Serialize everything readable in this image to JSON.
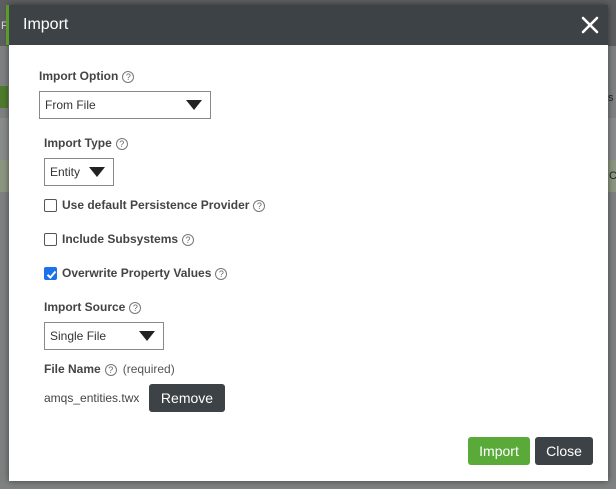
{
  "background": {
    "left_char": "F",
    "right_char_1": "s",
    "right_char_2": "C"
  },
  "dialog": {
    "title": "Import",
    "close_glyph": "×",
    "import_option": {
      "label": "Import Option",
      "value": "From File"
    },
    "import_type": {
      "label": "Import Type",
      "value": "Entity"
    },
    "checkboxes": [
      {
        "label": "Use default Persistence Provider",
        "checked": false
      },
      {
        "label": "Include Subsystems",
        "checked": false
      },
      {
        "label": "Overwrite Property Values",
        "checked": true
      }
    ],
    "import_source": {
      "label": "Import Source",
      "value": "Single File"
    },
    "file_name": {
      "label": "File Name",
      "required_note": "(required)",
      "value": "amqs_entities.twx"
    },
    "remove_label": "Remove",
    "import_label": "Import",
    "close_label": "Close",
    "help_glyph": "?"
  },
  "colors": {
    "header_bg": "#3d4246",
    "accent_green": "#5aaa3a",
    "checkbox_checked": "#1a73e8"
  }
}
